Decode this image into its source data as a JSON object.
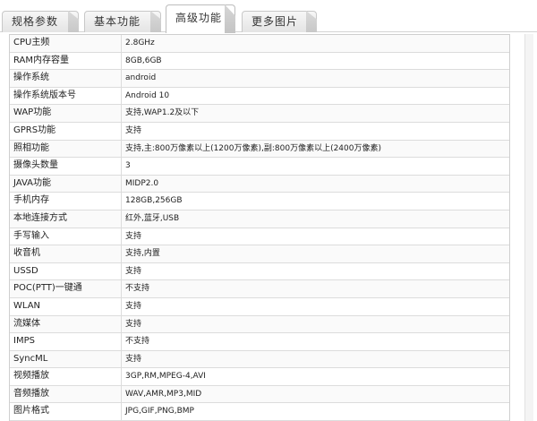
{
  "tabs": [
    {
      "label": "规格参数",
      "active": false
    },
    {
      "label": "基本功能",
      "active": false
    },
    {
      "label": "高级功能",
      "active": true
    },
    {
      "label": "更多图片",
      "active": false
    }
  ],
  "specs": [
    {
      "label": "CPU主频",
      "value": "2.8GHz"
    },
    {
      "label": "RAM内存容量",
      "value": "8GB,6GB"
    },
    {
      "label": "操作系统",
      "value": "android"
    },
    {
      "label": "操作系统版本号",
      "value": "Android 10"
    },
    {
      "label": "WAP功能",
      "value": "支持,WAP1.2及以下"
    },
    {
      "label": "GPRS功能",
      "value": "支持"
    },
    {
      "label": "照相功能",
      "value": "支持,主:800万像素以上(1200万像素),副:800万像素以上(2400万像素)"
    },
    {
      "label": "摄像头数量",
      "value": "3"
    },
    {
      "label": "JAVA功能",
      "value": "MIDP2.0"
    },
    {
      "label": "手机内存",
      "value": "128GB,256GB"
    },
    {
      "label": "本地连接方式",
      "value": "红外,蓝牙,USB"
    },
    {
      "label": "手写输入",
      "value": "支持"
    },
    {
      "label": "收音机",
      "value": "支持,内置"
    },
    {
      "label": "USSD",
      "value": "支持"
    },
    {
      "label": "POC(PTT)一键通",
      "value": "不支持"
    },
    {
      "label": "WLAN",
      "value": "支持"
    },
    {
      "label": "流媒体",
      "value": "支持"
    },
    {
      "label": "IMPS",
      "value": "不支持"
    },
    {
      "label": "SyncML",
      "value": "支持"
    },
    {
      "label": "视频播放",
      "value": "3GP,RM,MPEG-4,AVI"
    },
    {
      "label": "音频播放",
      "value": "WAV,AMR,MP3,MID"
    },
    {
      "label": "图片格式",
      "value": "JPG,GIF,PNG,BMP"
    }
  ]
}
